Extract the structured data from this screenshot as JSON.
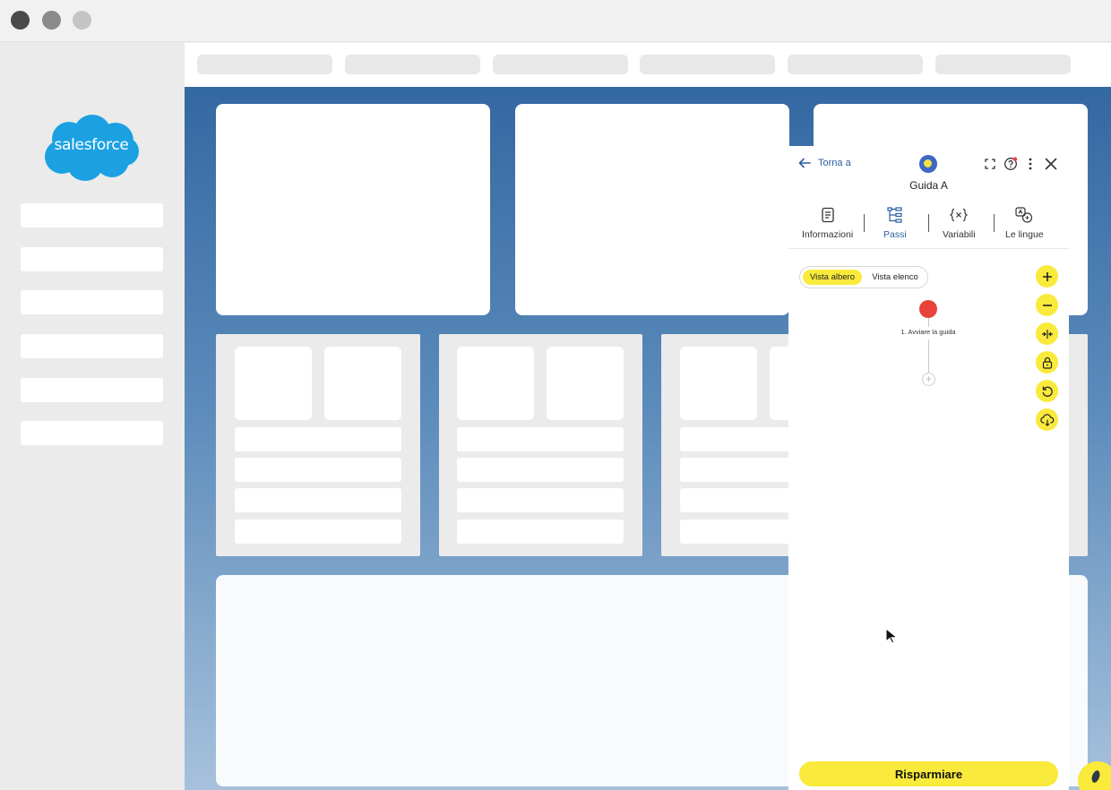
{
  "brand": {
    "logo_text": "salesforce",
    "cloud_color": "#1ba1e2"
  },
  "panel": {
    "back_label": "Torna a",
    "title": "Guida A",
    "tabs": [
      {
        "label": "Informazioni",
        "icon": "document-icon",
        "active": false
      },
      {
        "label": "Passi",
        "icon": "tree-steps-icon",
        "active": true
      },
      {
        "label": "Variabili",
        "icon": "variable-icon",
        "active": false
      },
      {
        "label": "Le lingue",
        "icon": "translate-icon",
        "active": false
      }
    ],
    "view_toggle": {
      "selected": "Vista albero",
      "other": "Vista elenco"
    },
    "tree": {
      "steps": [
        {
          "label": "1. Avviare la guida",
          "status_color": "#e8423a"
        }
      ]
    },
    "zoom_controls": [
      "plus-icon",
      "minus-icon",
      "collapse-icon",
      "lock-icon",
      "undo-icon",
      "cloud-download-icon"
    ],
    "save_label": "Risparmiare"
  },
  "colors": {
    "accent_yellow": "#f9ea3b",
    "link_blue": "#2c5e9e",
    "main_blue": "#3468a1"
  }
}
